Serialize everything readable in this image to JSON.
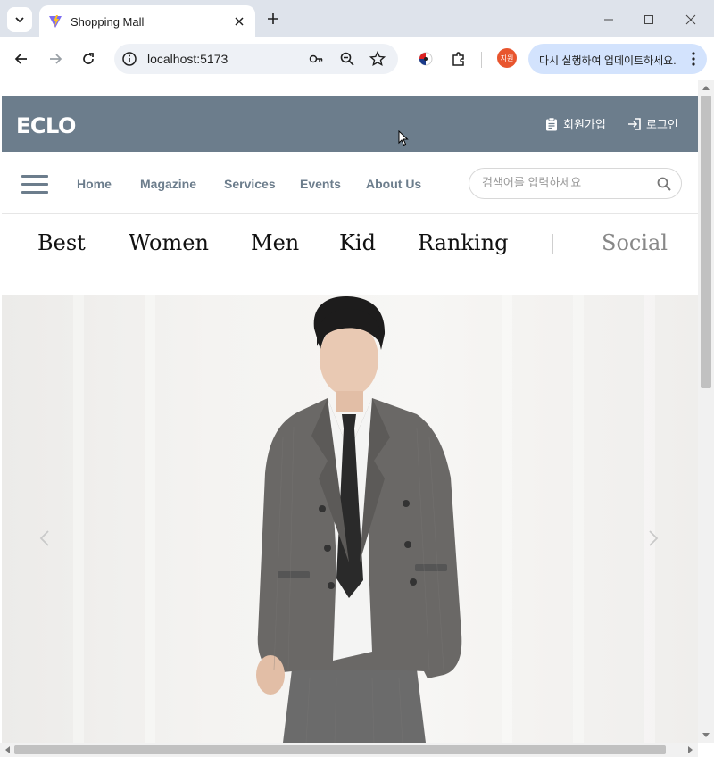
{
  "browser": {
    "tab_title": "Shopping Mall",
    "url": "localhost:5173",
    "profile_label": "지원",
    "update_label": "다시 실행하여 업데이트하세요."
  },
  "site": {
    "logo": "ECLO",
    "signup_label": "회원가입",
    "login_label": "로그인",
    "nav": [
      "Home",
      "Magazine",
      "Services",
      "Events",
      "About Us"
    ],
    "search_placeholder": "검색어를 입력하세요",
    "categories": [
      "Best",
      "Women",
      "Men",
      "Kid",
      "Ranking"
    ],
    "social_label": "Social"
  },
  "colors": {
    "brand": "#6c7d8c",
    "update_pill": "#d3e3fd",
    "avatar": "#e8552e"
  },
  "icons": {
    "signup": "clipboard-icon",
    "login": "login-arrow-icon",
    "search": "magnifier-icon",
    "menu": "hamburger-icon"
  }
}
